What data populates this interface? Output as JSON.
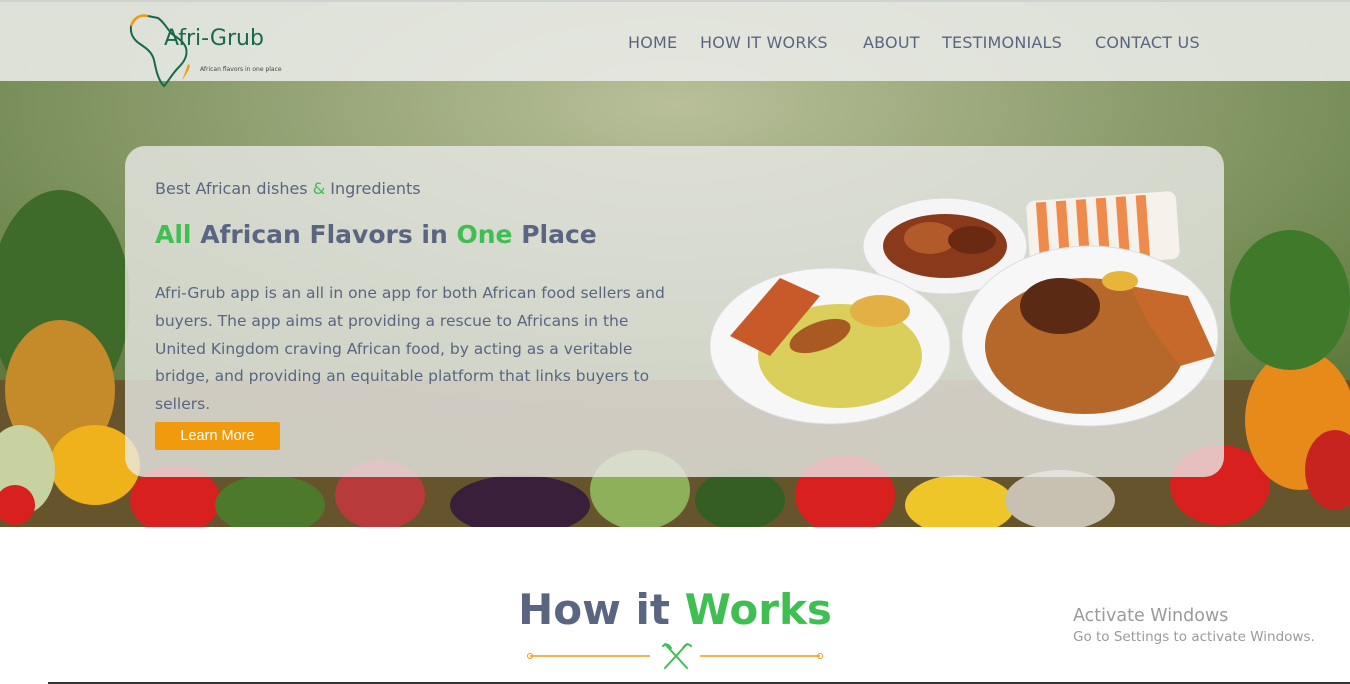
{
  "brand": {
    "name": "Afri-Grub",
    "tagline": "African flavors in one place"
  },
  "nav": {
    "items": [
      {
        "label": "HOME"
      },
      {
        "label": "HOW IT WORKS"
      },
      {
        "label": "ABOUT"
      },
      {
        "label": "TESTIMONIALS"
      },
      {
        "label": "CONTACT US"
      }
    ]
  },
  "hero": {
    "eyebrow_part1": "Best African dishes ",
    "eyebrow_amp": "&",
    "eyebrow_part2": " Ingredients",
    "headline_all": "All",
    "headline_mid": " African Flavors in ",
    "headline_one": "One",
    "headline_end": " Place",
    "description": "Afri-Grub app is an all in one app for both African food sellers and buyers. The app aims at providing a rescue to Africans in the United Kingdom craving African food, by acting as a veritable bridge, and providing an equitable platform that links buyers to sellers.",
    "cta_label": "Learn More"
  },
  "how_it_works": {
    "title_part1": "How it ",
    "title_part2": "Works"
  },
  "windows_notice": {
    "title": "Activate Windows",
    "subtitle": "Go to Settings to activate Windows."
  },
  "colors": {
    "accent_green": "#3fbe52",
    "text_slate": "#5a6581",
    "button_orange": "#f29a0d",
    "brand_green": "#176a4a"
  }
}
